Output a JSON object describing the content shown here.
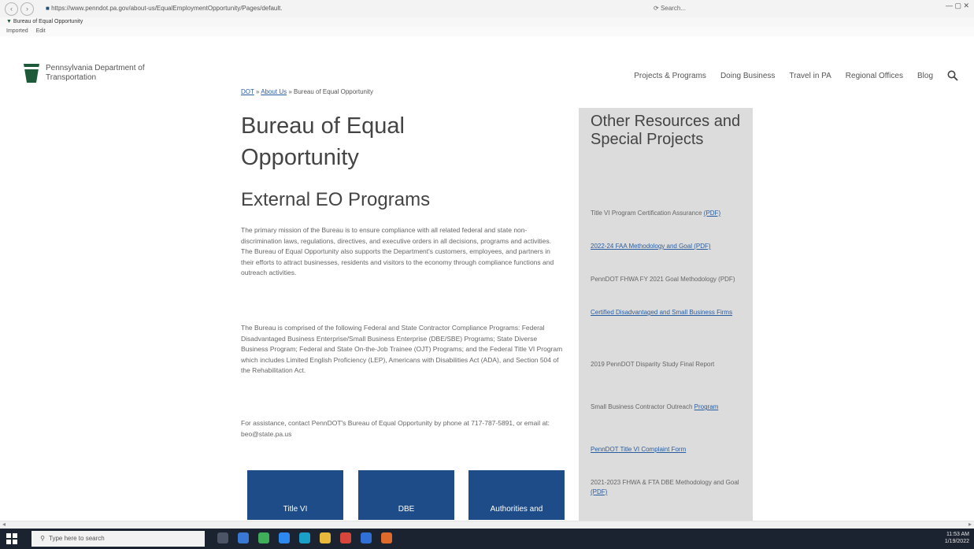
{
  "browser": {
    "address": "https://www.penndot.pa.gov/about-us/EqualEmploymentOpportunity/Pages/default.aspx",
    "search_placeholder": "Search...",
    "tab_title": "Bureau of Equal Opportunity",
    "favorites": [
      "Imported",
      "Edit"
    ],
    "window_controls": "—  ▢  ✕"
  },
  "header": {
    "org_name": "Pennsylvania Department of Transportation",
    "nav": [
      "Projects & Programs",
      "Doing Business",
      "Travel in PA",
      "Regional Offices",
      "Blog"
    ]
  },
  "breadcrumb": {
    "home": "DOT",
    "about": "About Us",
    "current": "Bureau of Equal Opportunity",
    "sep": " » "
  },
  "content": {
    "title": "Bureau of Equal Opportunity",
    "subtitle": "External EO Programs",
    "p1": "The primary mission of the Bureau is to ensure compliance with all related federal and state non-discrimination laws, regulations, directives, and executive orders in all decisions, programs and activities. The Bureau of Equal Opportunity also supports the Department's customers, employees, and partners in their efforts to attract businesses, residents and visitors to the economy through compliance functions and outreach activities.",
    "p2": "The Bureau is comprised of the following Federal and State Contractor Compliance Programs: Federal Disadvantaged Business Enterprise/Small Business Enterprise (DBE/SBE) Programs; State Diverse Business Program; Federal and State On-the-Job Trainee (OJT) Programs; and the Federal Title VI Program which includes Limited English Proficiency (LEP), Americans with Disabilities Act (ADA), and Section 504 of the Rehabilitation Act.",
    "p3": "For assistance, contact PennDOT's Bureau of Equal Opportunity by phone at 717-787-5891, or email at: beo@state.pa.us",
    "tiles": [
      "Title VI",
      "DBE",
      "Authorities and"
    ]
  },
  "sidebar": {
    "heading": "Other Resources and Special Projects",
    "items": [
      {
        "text": "Title VI Program Certification Assurance",
        "link": "(PDF)"
      },
      {
        "text": "",
        "link": "2022-24 FAA Methodology and Goal (PDF)"
      },
      {
        "text": "PennDOT FHWA FY 2021 Goal Methodology (PDF)",
        "link": ""
      },
      {
        "text": "",
        "link": "Certified Disadvantaged and Small Business Firms"
      },
      {
        "text": "2019 PennDOT Disparity Study Final Report",
        "link": ""
      },
      {
        "text": "Small Business Contractor Outreach",
        "link": "Program"
      },
      {
        "text": "",
        "link": "PennDOT Title VI Complaint Form"
      },
      {
        "text": "2021-2023 FHWA & FTA DBE Methodology and Goal",
        "link": "(PDF)"
      }
    ]
  },
  "taskbar": {
    "search_placeholder": "Type here to search",
    "time": "11:53 AM",
    "date": "1/19/2022"
  },
  "colors": {
    "tile_blue": "#1e4c88",
    "sidebar_gray": "#dcdcdc",
    "link_blue": "#2a5d9f",
    "keystone_green": "#1c5a3a"
  }
}
